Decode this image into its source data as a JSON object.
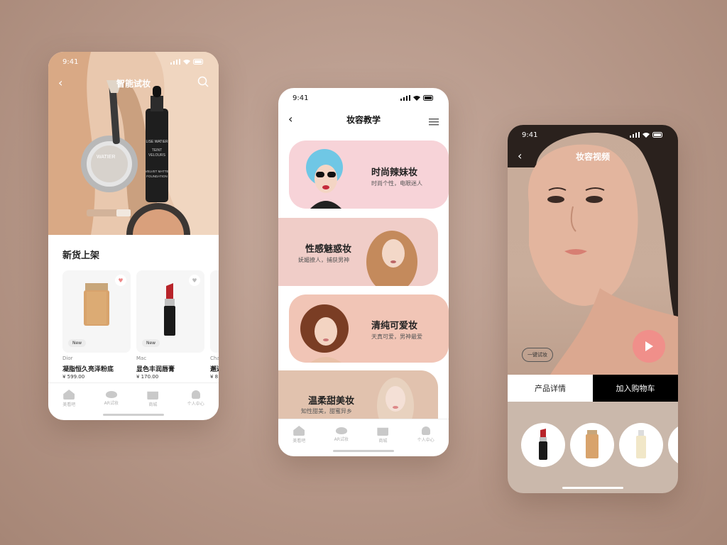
{
  "time": "9:41",
  "phone1": {
    "title": "智能试妆",
    "section_title": "新货上架",
    "products": [
      {
        "brand": "Dior",
        "name": "凝脂恒久亮泽粉底",
        "price": "¥ 599.00",
        "badge": "New"
      },
      {
        "brand": "Mac",
        "name": "显色丰润唇膏",
        "price": "¥ 170.00",
        "badge": "New"
      },
      {
        "brand": "Cha",
        "name": "邂逅",
        "price": "¥ 8",
        "badge": ""
      }
    ],
    "hero_text": {
      "brand_left": "WATIER",
      "brand_bottle": "LISE WATIER",
      "bottle_line1": "TEINT",
      "bottle_line2": "VELOURS",
      "bottle_line3": "VELVET MATTE",
      "bottle_line4": "FOUNDATION"
    },
    "tabs": [
      "美看吧",
      "AR试妆",
      "商城",
      "个人中心"
    ]
  },
  "phone2": {
    "title": "妆容教学",
    "banners": [
      {
        "title": "时尚辣妹妆",
        "subtitle": "时尚个性，电眼迷人"
      },
      {
        "title": "性感魅惑妆",
        "subtitle": "妩媚撩人，捕获男神"
      },
      {
        "title": "清纯可爱妆",
        "subtitle": "天真可爱，男神最爱"
      },
      {
        "title": "温柔甜美妆",
        "subtitle": "知性甜美，甜蜜异乡"
      }
    ],
    "tabs": [
      "美看吧",
      "AR试妆",
      "商城",
      "个人中心"
    ]
  },
  "phone3": {
    "title": "妆容视频",
    "trial_button": "一键试妆",
    "tab_details": "产品详情",
    "tab_cart": "加入购物车"
  },
  "colors": {
    "banner_pink": "#f7d3d8",
    "banner_rose": "#f0cdc8",
    "banner_peach": "#f1c5b6",
    "banner_nude": "#e1c2ae",
    "play": "#f08f8a"
  }
}
